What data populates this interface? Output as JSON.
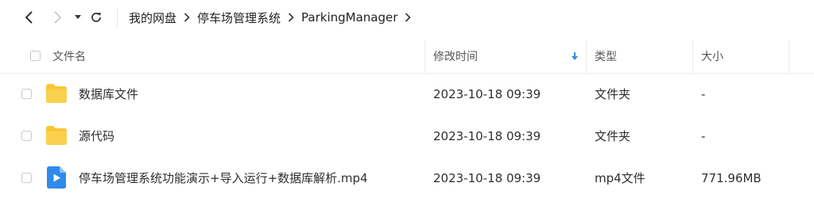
{
  "breadcrumb": [
    "我的网盘",
    "停车场管理系统",
    "ParkingManager"
  ],
  "columns": {
    "name": "文件名",
    "modified": "修改时间",
    "type": "类型",
    "size": "大小"
  },
  "sort": {
    "column": "modified",
    "direction": "descending"
  },
  "files": [
    {
      "name": "数据库文件",
      "modified": "2023-10-18 09:39",
      "type": "文件夹",
      "size": "-",
      "icon": "folder-icon"
    },
    {
      "name": "源代码",
      "modified": "2023-10-18 09:39",
      "type": "文件夹",
      "size": "-",
      "icon": "folder-icon"
    },
    {
      "name": "停车场管理系统功能演示+导入运行+数据库解析.mp4",
      "modified": "2023-10-18 09:39",
      "type": "mp4文件",
      "size": "771.96MB",
      "icon": "video-file-icon"
    }
  ],
  "colors": {
    "folder": "#F8C635",
    "video": "#2F8BEA",
    "sort_arrow": "#2F8BEA"
  }
}
